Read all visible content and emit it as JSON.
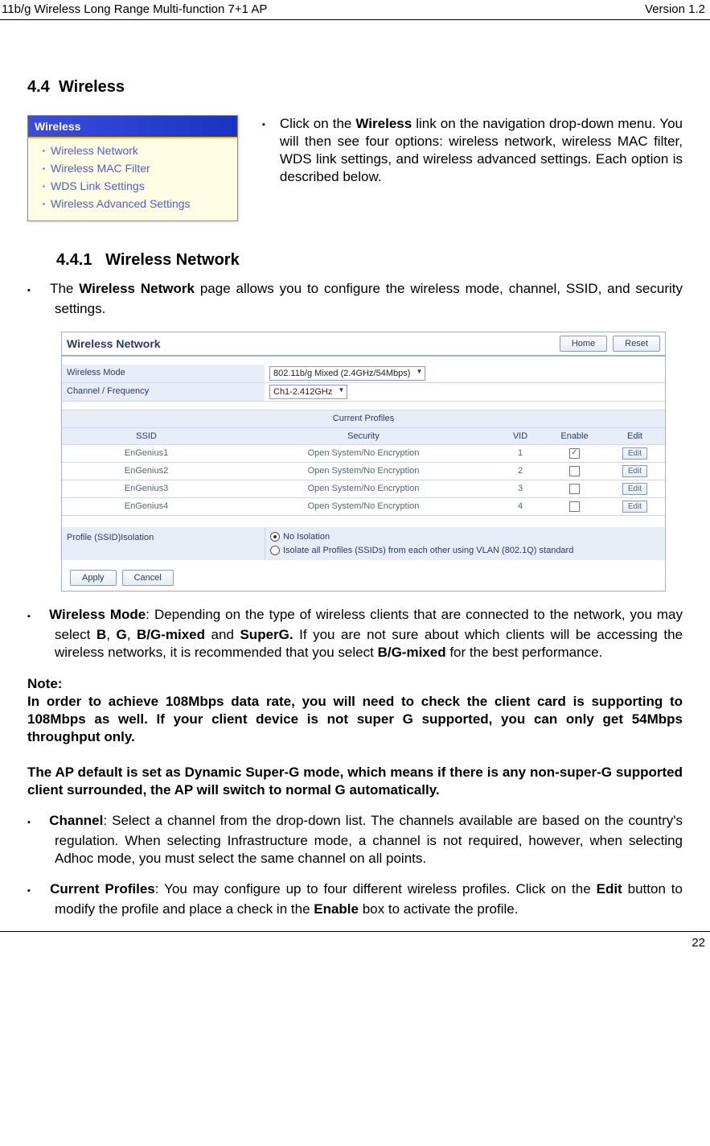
{
  "header": {
    "left": "11b/g Wireless Long Range Multi-function 7+1 AP",
    "right": "Version 1.2"
  },
  "section": {
    "number": "4.4",
    "title": "Wireless"
  },
  "sideMenu": {
    "title": "Wireless",
    "items": [
      "Wireless Network",
      "Wireless MAC Filter",
      "WDS Link Settings",
      "Wireless Advanced Settings"
    ]
  },
  "introBullet": "Click on the Wireless link on the navigation drop-down menu. You will then see four options: wireless network, wireless MAC filter, WDS link settings, and wireless advanced settings. Each option is described below.",
  "introBold": "Wireless",
  "subsection": {
    "number": "4.4.1",
    "title": "Wireless Network"
  },
  "netBullet": {
    "prefix": "The ",
    "bold": "Wireless Network",
    "rest": " page allows you to configure the wireless mode, channel, SSID, and security settings."
  },
  "shot": {
    "title": "Wireless Network",
    "homeBtn": "Home",
    "resetBtn": "Reset",
    "modeLabel": "Wireless Mode",
    "modeValue": "802.11b/g Mixed (2.4GHz/54Mbps)",
    "chanLabel": "Channel / Frequency",
    "chanValue": "Ch1-2.412GHz",
    "profilesTitle": "Current Profiles",
    "cols": {
      "ssid": "SSID",
      "security": "Security",
      "vid": "VID",
      "enable": "Enable",
      "edit": "Edit"
    },
    "rows": [
      {
        "ssid": "EnGenius1",
        "sec": "Open System/No Encryption",
        "vid": "1",
        "en": true
      },
      {
        "ssid": "EnGenius2",
        "sec": "Open System/No Encryption",
        "vid": "2",
        "en": false
      },
      {
        "ssid": "EnGenius3",
        "sec": "Open System/No Encryption",
        "vid": "3",
        "en": false
      },
      {
        "ssid": "EnGenius4",
        "sec": "Open System/No Encryption",
        "vid": "4",
        "en": false
      }
    ],
    "editLabel": "Edit",
    "isoLabel": "Profile (SSID)Isolation",
    "isoOpt1": "No Isolation",
    "isoOpt2": "Isolate all Profiles (SSIDs) from each other using VLAN (802.1Q) standard",
    "applyBtn": "Apply",
    "cancelBtn": "Cancel"
  },
  "wmode": {
    "lead": "Wireless Mode",
    "text1": ": Depending on the type of wireless clients that are connected to the network, you may select ",
    "b": "B",
    "comma1": ", ",
    "g": "G",
    "comma2": ", ",
    "bg": "B/G-mixed",
    "and": " and ",
    "sg": "SuperG.",
    "text2": " If you are not sure about which clients will be accessing the wireless networks, it is recommended that you select ",
    "bg2": "B/G-mixed",
    "text3": " for the best performance."
  },
  "note": {
    "label": "Note:",
    "body1": "In order to achieve 108Mbps data rate, you will need to check the client card is supporting to 108Mbps as well. If your client device is not super G supported, you can only get 54Mbps throughput only.",
    "body2": "The AP default is set as Dynamic Super-G mode, which means if there is any non-super-G supported client surrounded, the AP will switch to normal G automatically."
  },
  "channel": {
    "lead": "Channel",
    "text": ": Select a channel from the drop-down list. The channels available are based on the country's regulation. When selecting Infrastructure mode, a channel is not required, however, when selecting Adhoc mode, you must select the same channel on all points."
  },
  "current": {
    "lead": "Current Profiles",
    "t1": ": You may configure up to four different wireless profiles. Click on the ",
    "edit": "Edit",
    "t2": " button to modify the profile and place a check in the ",
    "enable": "Enable",
    "t3": " box to activate the profile."
  },
  "footer": {
    "page": "22"
  }
}
